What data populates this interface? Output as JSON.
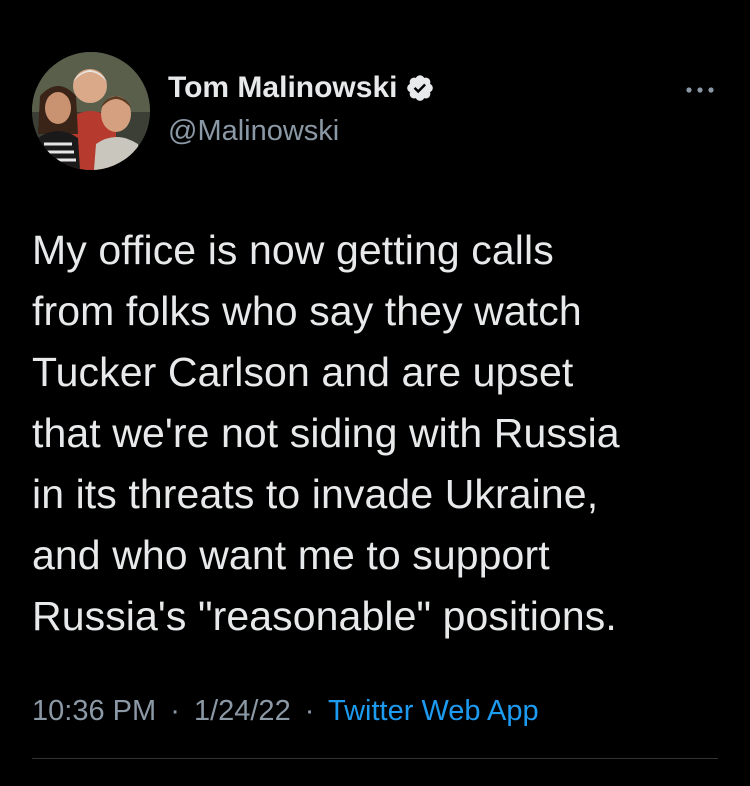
{
  "tweet": {
    "author": {
      "display_name": "Tom Malinowski",
      "handle": "@Malinowski",
      "verified": true,
      "avatar_icon": "profile-photo"
    },
    "text": "My office is now getting calls\nfrom folks who say they watch\nTucker Carlson and are upset\nthat we're not siding with Russia\nin its threats to invade Ukraine,\nand who want me to support\nRussia's \"reasonable\" positions.",
    "time": "10:36 PM",
    "separator": "·",
    "date": "1/24/22",
    "source": "Twitter Web App"
  },
  "icons": {
    "verified": "verified-badge-icon",
    "more": "more-options-icon"
  },
  "colors": {
    "background": "#000000",
    "text_primary": "#e7e9ea",
    "text_secondary": "#8b98a5",
    "accent": "#1d9bf0",
    "divider": "#2f3336"
  }
}
